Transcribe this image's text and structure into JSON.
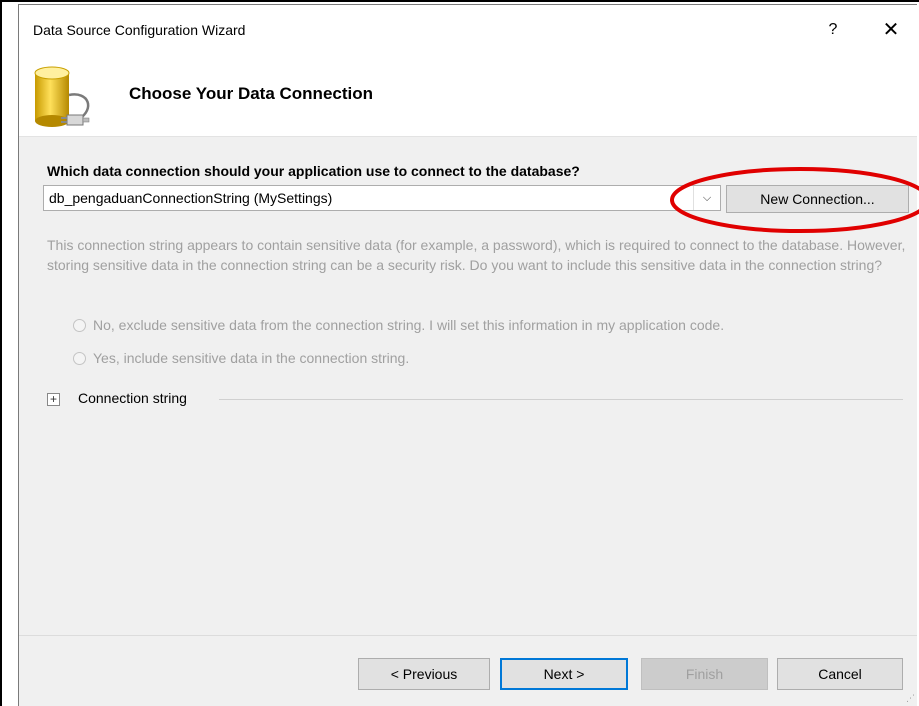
{
  "window": {
    "title": "Data Source Configuration Wizard",
    "help_label": "?",
    "close_label": "✕"
  },
  "header": {
    "title": "Choose Your Data Connection",
    "icon": "database-plug-icon"
  },
  "connection": {
    "question": "Which data connection should your application use to connect to the database?",
    "selected": "db_pengaduanConnectionString (MySettings)",
    "chevron": "⌵",
    "new_connection_label": "New Connection..."
  },
  "sensitive": {
    "description": "This connection string appears to contain sensitive data (for example, a password), which is required to connect to the database. However, storing sensitive data in the connection string can be a security risk. Do you want to include this sensitive data in the connection string?",
    "option_no": "No, exclude sensitive data from the connection string. I will set this information in my application code.",
    "option_yes": "Yes, include sensitive data in the connection string."
  },
  "connection_string": {
    "expander_symbol": "+",
    "label": "Connection string"
  },
  "footer": {
    "previous_label": "< Previous",
    "next_label": "Next >",
    "finish_label": "Finish",
    "cancel_label": "Cancel"
  },
  "colors": {
    "highlight": "#e00000",
    "accent": "#0078d7",
    "dialog_bg": "#f0f0f0",
    "disabled_text": "#a0a0a0"
  }
}
